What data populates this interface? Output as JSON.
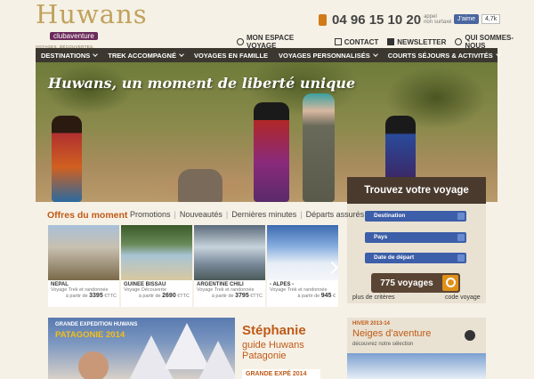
{
  "logo": {
    "name": "Huwans",
    "sub": "clubaventure",
    "tagline": "VOYAGES, DÉCOUVERTES, RENCONTRES"
  },
  "header": {
    "phone": "04 96 15 10 20",
    "phone_note_1": "appel",
    "phone_note_2": "non surtaxé",
    "fb_like": "J'aime",
    "fb_count": "4,7k",
    "links": [
      "MON ESPACE VOYAGE",
      "CONTACT",
      "NEWSLETTER",
      "QUI SOMMES-NOUS"
    ]
  },
  "nav": {
    "items": [
      "DESTINATIONS",
      "TREK ACCOMPAGNÉ",
      "VOYAGES EN FAMILLE",
      "VOYAGES PERSONNALISÉS",
      "COURTS SÉJOURS & ACTIVITÉS"
    ]
  },
  "hero": {
    "title": "Huwans, un moment de liberté unique"
  },
  "search": {
    "title": "Trouvez votre voyage",
    "destination": "Destination",
    "pays": "Pays",
    "date": "Date de départ",
    "count": "775 voyages",
    "more_criteria": "plus de critères",
    "code_voyage": "code voyage"
  },
  "offers": {
    "title": "Offres du moment",
    "tabs": [
      "Promotions",
      "Nouveautés",
      "Dernières minutes",
      "Départs assurés"
    ],
    "cards": [
      {
        "name": "NEPAL",
        "sub": "Voyage Trek et randonnée",
        "prefix": "à partir de",
        "price": "3395",
        "unit": "€TTC"
      },
      {
        "name": "GUINEE BISSAU",
        "sub": "Voyage Découverte",
        "prefix": "à partir de",
        "price": "2690",
        "unit": "€TTC"
      },
      {
        "name": "ARGENTINE CHILI",
        "sub": "Voyage Trek et randonnée",
        "prefix": "à partir de",
        "price": "3795",
        "unit": "€TTC"
      },
      {
        "name": "- ALPES -",
        "sub": "Voyage Trek et randonnée",
        "prefix": "à partir de",
        "price": "945",
        "unit": "€"
      }
    ]
  },
  "promo": {
    "label": "GRANDE EXPEDITION HUWANS",
    "title": "PATAGONIE 2014",
    "person": "Stéphanie",
    "role_1": "guide Huwans",
    "role_2": "Patagonie",
    "cta": "GRANDE EXPÉ 2014"
  },
  "hiver": {
    "label": "HIVER 2013-14",
    "title": "Neiges d'aventure",
    "sub": "découvrez notre sélection"
  },
  "colors": {
    "nav_bg": "#3c3830",
    "accent": "#c05a18",
    "select_blue": "#3d5ea8",
    "search_btn": "#5a4534"
  }
}
